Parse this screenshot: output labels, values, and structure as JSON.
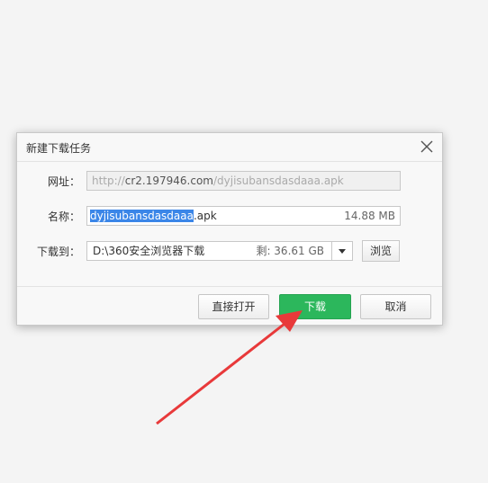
{
  "dialog": {
    "title": "新建下载任务",
    "url_label": "网址：",
    "url_prefix": "http://",
    "url_host": "cr2.197946.com",
    "url_path": "/dyjisubansdasdaaa.apk",
    "name_label": "名称：",
    "name_selected": "dyjisubansdasdaaa",
    "name_ext": ".apk",
    "name_size": "14.88 MB",
    "path_label": "下载到：",
    "path_value": "D:\\360安全浏览器下载",
    "path_space": "剩: 36.61 GB",
    "browse_label": "浏览",
    "open_label": "直接打开",
    "download_label": "下载",
    "cancel_label": "取消"
  },
  "annotation": {
    "arrow_color": "#e8393a"
  },
  "colors": {
    "accent": "#2cb75c",
    "selection": "#3b86e8"
  }
}
